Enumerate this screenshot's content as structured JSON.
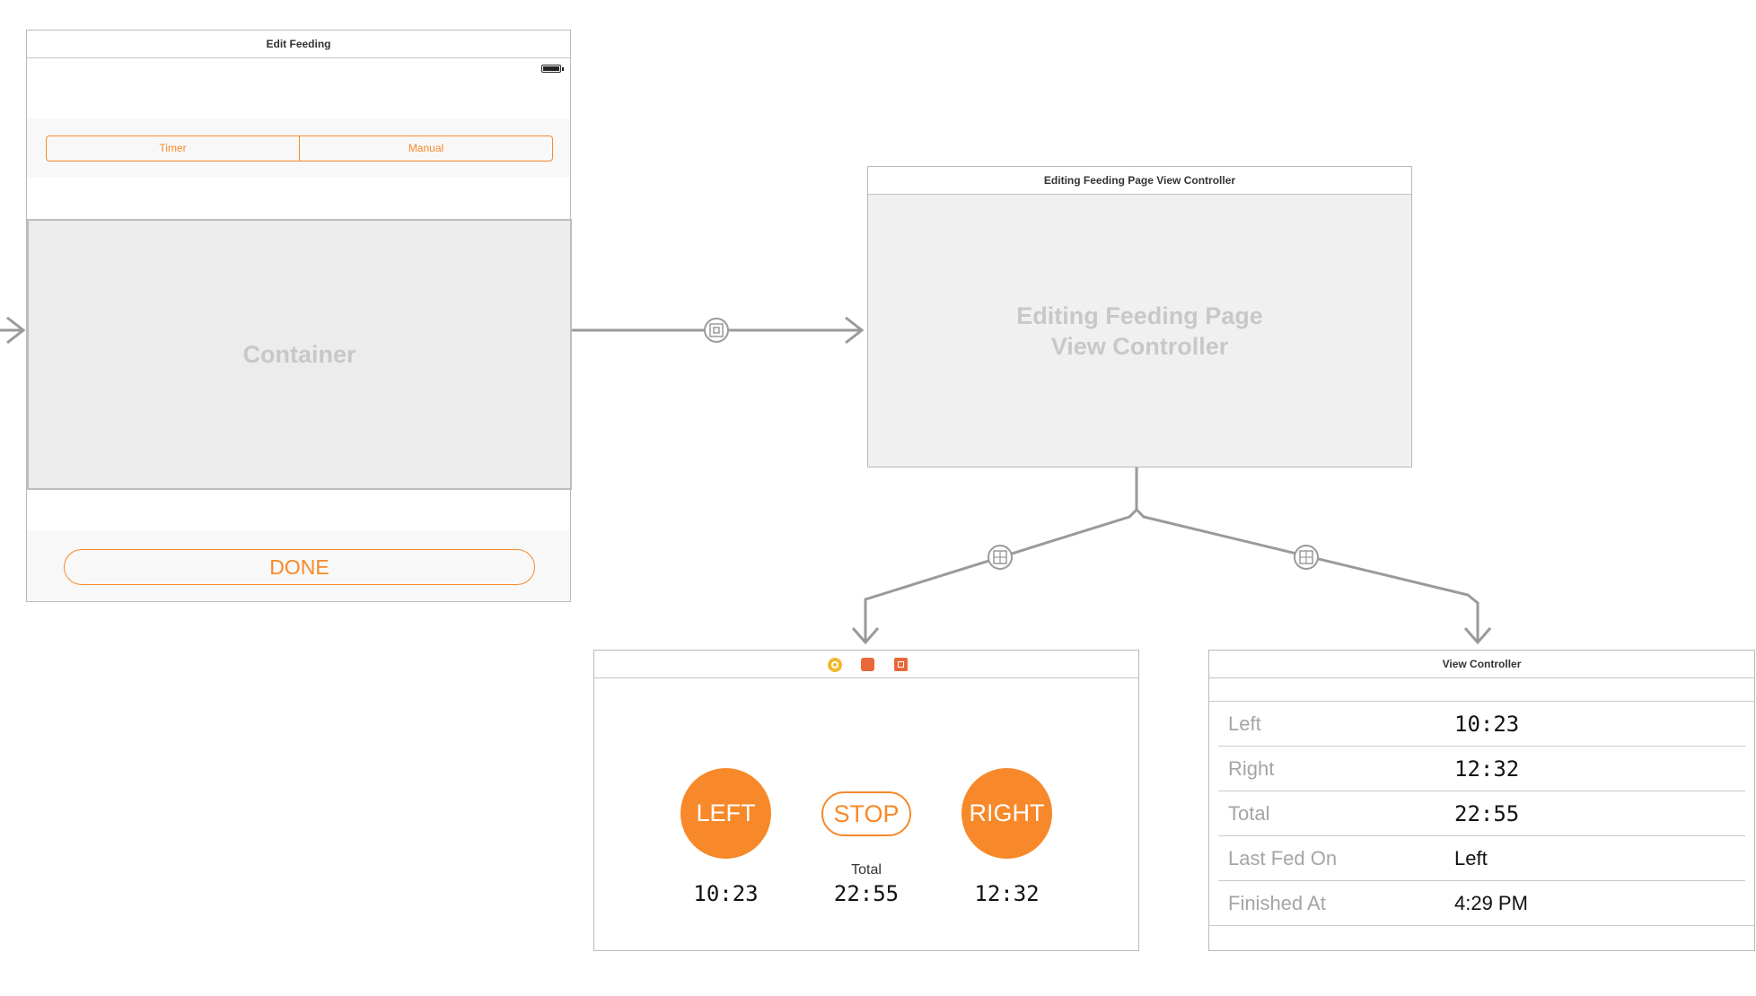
{
  "edit_feeding": {
    "title": "Edit Feeding",
    "segments": [
      "Timer",
      "Manual"
    ],
    "container_label": "Container",
    "done_label": "DONE"
  },
  "page_vc": {
    "title": "Editing Feeding Page View Controller",
    "placeholder_line1": "Editing Feeding Page",
    "placeholder_line2": "View Controller"
  },
  "timer_vc": {
    "left_label": "LEFT",
    "stop_label": "STOP",
    "right_label": "RIGHT",
    "total_caption": "Total",
    "left_time": "10:23",
    "total_time": "22:55",
    "right_time": "12:32"
  },
  "manual_vc": {
    "title": "View Controller",
    "rows": [
      {
        "label": "Left",
        "value": "10:23"
      },
      {
        "label": "Right",
        "value": "12:32"
      },
      {
        "label": "Total",
        "value": "22:55"
      },
      {
        "label": "Last Fed On",
        "value": "Left"
      },
      {
        "label": "Finished At",
        "value": "4:29 PM"
      }
    ]
  },
  "colors": {
    "accent": "#f7892a",
    "segue_line": "#9a9a9a",
    "placeholder_text": "#c8c8c8"
  },
  "icons": [
    "arrow-right-icon",
    "embed-segue-icon",
    "page-segue-icon",
    "first-responder-icon",
    "object-cube-icon",
    "exit-icon",
    "battery-icon"
  ]
}
